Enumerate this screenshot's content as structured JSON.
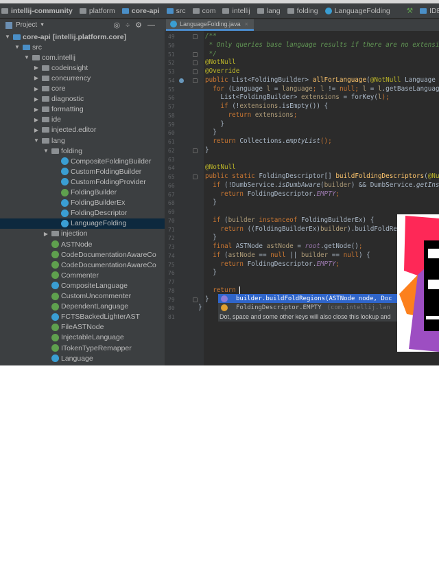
{
  "navbar": {
    "crumbs": [
      {
        "label": "intellij-community",
        "icon": "project-icon",
        "bold": true
      },
      {
        "label": "platform",
        "icon": "folder-icon"
      },
      {
        "label": "core-api",
        "icon": "module-icon",
        "bold": true
      },
      {
        "label": "src",
        "icon": "source-folder-icon"
      },
      {
        "label": "com",
        "icon": "folder-icon"
      },
      {
        "label": "intellij",
        "icon": "folder-icon"
      },
      {
        "label": "lang",
        "icon": "folder-icon"
      },
      {
        "label": "folding",
        "icon": "folder-icon"
      },
      {
        "label": "LanguageFolding",
        "icon": "class-icon"
      }
    ],
    "right_label": "IDE"
  },
  "tool_window": {
    "title": "Project"
  },
  "editor_tab": {
    "label": "LanguageFolding.java"
  },
  "tree": [
    {
      "label": "core-api [intellij.platform.core]",
      "depth": 0,
      "arrow": "down",
      "icon": "module",
      "bold": true
    },
    {
      "label": "src",
      "depth": 1,
      "arrow": "down",
      "icon": "src"
    },
    {
      "label": "com.intellij",
      "depth": 2,
      "arrow": "down",
      "icon": "folder"
    },
    {
      "label": "codeinsight",
      "depth": 3,
      "arrow": "right",
      "icon": "folder"
    },
    {
      "label": "concurrency",
      "depth": 3,
      "arrow": "right",
      "icon": "folder"
    },
    {
      "label": "core",
      "depth": 3,
      "arrow": "right",
      "icon": "folder"
    },
    {
      "label": "diagnostic",
      "depth": 3,
      "arrow": "right",
      "icon": "folder"
    },
    {
      "label": "formatting",
      "depth": 3,
      "arrow": "right",
      "icon": "folder"
    },
    {
      "label": "ide",
      "depth": 3,
      "arrow": "right",
      "icon": "folder"
    },
    {
      "label": "injected.editor",
      "depth": 3,
      "arrow": "right",
      "icon": "folder"
    },
    {
      "label": "lang",
      "depth": 3,
      "arrow": "down",
      "icon": "folder"
    },
    {
      "label": "folding",
      "depth": 4,
      "arrow": "down",
      "icon": "folder"
    },
    {
      "label": "CompositeFoldingBuilder",
      "depth": 5,
      "icon": "c"
    },
    {
      "label": "CustomFoldingBuilder",
      "depth": 5,
      "icon": "c"
    },
    {
      "label": "CustomFoldingProvider",
      "depth": 5,
      "icon": "c"
    },
    {
      "label": "FoldingBuilder",
      "depth": 5,
      "icon": "i"
    },
    {
      "label": "FoldingBuilderEx",
      "depth": 5,
      "icon": "c"
    },
    {
      "label": "FoldingDescriptor",
      "depth": 5,
      "icon": "c"
    },
    {
      "label": "LanguageFolding",
      "depth": 5,
      "icon": "c",
      "selected": true
    },
    {
      "label": "injection",
      "depth": 4,
      "arrow": "right",
      "icon": "folder"
    },
    {
      "label": "ASTNode",
      "depth": 4,
      "icon": "i"
    },
    {
      "label": "CodeDocumentationAwareCo",
      "depth": 4,
      "icon": "i"
    },
    {
      "label": "CodeDocumentationAwareCo",
      "depth": 4,
      "icon": "i"
    },
    {
      "label": "Commenter",
      "depth": 4,
      "icon": "i"
    },
    {
      "label": "CompositeLanguage",
      "depth": 4,
      "icon": "c"
    },
    {
      "label": "CustomUncommenter",
      "depth": 4,
      "icon": "i"
    },
    {
      "label": "DependentLanguage",
      "depth": 4,
      "icon": "i"
    },
    {
      "label": "FCTSBackedLighterAST",
      "depth": 4,
      "icon": "c"
    },
    {
      "label": "FileASTNode",
      "depth": 4,
      "icon": "i"
    },
    {
      "label": "InjectableLanguage",
      "depth": 4,
      "icon": "i"
    },
    {
      "label": "ITokenTypeRemapper",
      "depth": 4,
      "icon": "i"
    },
    {
      "label": "Language",
      "depth": 4,
      "icon": "c"
    }
  ],
  "code": [
    {
      "n": "49",
      "s": [
        [
          "/**",
          "c"
        ]
      ]
    },
    {
      "n": "50",
      "s": [
        [
          " * Only queries base language results if there are no extensio",
          "c"
        ]
      ]
    },
    {
      "n": "51",
      "s": [
        [
          " */",
          "c"
        ]
      ]
    },
    {
      "n": "52",
      "s": [
        [
          "@NotNull",
          "a"
        ]
      ]
    },
    {
      "n": "53",
      "s": [
        [
          "@Override",
          "a"
        ]
      ]
    },
    {
      "n": "54",
      "s": [
        [
          "public ",
          "k"
        ],
        [
          "List<FoldingBuilder> ",
          ""
        ],
        [
          "allForLanguage",
          "m"
        ],
        [
          "(",
          ""
        ],
        [
          "@NotNull ",
          "a"
        ],
        [
          "Language l",
          ""
        ]
      ]
    },
    {
      "n": "55",
      "s": [
        [
          "  for ",
          "k"
        ],
        [
          "(Language ",
          ""
        ],
        [
          "l",
          "lv"
        ],
        [
          " = ",
          ""
        ],
        [
          "language",
          "lv"
        ],
        [
          "; ",
          "k"
        ],
        [
          "l",
          "lv"
        ],
        [
          " != ",
          ""
        ],
        [
          "null",
          "k"
        ],
        [
          "; ",
          "k"
        ],
        [
          "l",
          "lv"
        ],
        [
          " = ",
          ""
        ],
        [
          "l",
          "lv"
        ],
        [
          ".getBaseLanguage",
          ""
        ]
      ]
    },
    {
      "n": "56",
      "s": [
        [
          "    List<FoldingBuilder> ",
          ""
        ],
        [
          "extensions",
          "lv"
        ],
        [
          " = forKey(",
          ""
        ],
        [
          "l",
          "lv"
        ],
        [
          ");",
          "k"
        ]
      ]
    },
    {
      "n": "57",
      "s": [
        [
          "    if ",
          "k"
        ],
        [
          "(!",
          ""
        ],
        [
          "extensions",
          "lv"
        ],
        [
          ".isEmpty()) {",
          ""
        ]
      ]
    },
    {
      "n": "58",
      "s": [
        [
          "      return ",
          "k"
        ],
        [
          "extensions",
          "lv"
        ],
        [
          ";",
          "k"
        ]
      ]
    },
    {
      "n": "59",
      "s": [
        [
          "    }",
          ""
        ]
      ]
    },
    {
      "n": "60",
      "s": [
        [
          "  }",
          ""
        ]
      ]
    },
    {
      "n": "61",
      "s": [
        [
          "  return ",
          "k"
        ],
        [
          "Collections.",
          ""
        ],
        [
          "emptyList",
          "it"
        ],
        [
          "();",
          "k"
        ]
      ]
    },
    {
      "n": "62",
      "s": [
        [
          "}",
          ""
        ]
      ]
    },
    {
      "n": "63",
      "s": []
    },
    {
      "n": "64",
      "s": [
        [
          "@NotNull",
          "a"
        ]
      ]
    },
    {
      "n": "65",
      "s": [
        [
          "public static ",
          "k"
        ],
        [
          "FoldingDescriptor[] ",
          ""
        ],
        [
          "buildFoldingDescriptors",
          "m"
        ],
        [
          "(",
          ""
        ],
        [
          "@Nul",
          "a"
        ]
      ]
    },
    {
      "n": "66",
      "s": [
        [
          "  if ",
          "k"
        ],
        [
          "(!DumbService.",
          ""
        ],
        [
          "isDumbAware",
          "it"
        ],
        [
          "(",
          ""
        ],
        [
          "builder",
          "lv"
        ],
        [
          ") && DumbService.",
          ""
        ],
        [
          "getInst",
          "it"
        ]
      ]
    },
    {
      "n": "67",
      "s": [
        [
          "    return ",
          "k"
        ],
        [
          "FoldingDescriptor.",
          ""
        ],
        [
          "EMPTY",
          "f"
        ],
        [
          ";",
          "k"
        ]
      ]
    },
    {
      "n": "68",
      "s": [
        [
          "  }",
          ""
        ]
      ]
    },
    {
      "n": "69",
      "s": []
    },
    {
      "n": "70",
      "s": [
        [
          "  if ",
          "k"
        ],
        [
          "(",
          ""
        ],
        [
          "builder ",
          "lv"
        ],
        [
          "instanceof ",
          "k"
        ],
        [
          "FoldingBuilderEx) {",
          ""
        ]
      ]
    },
    {
      "n": "71",
      "s": [
        [
          "    return ",
          "k"
        ],
        [
          "((FoldingBuilderEx)",
          ""
        ],
        [
          "builder",
          "lv"
        ],
        [
          ").buildFoldReg",
          ""
        ]
      ]
    },
    {
      "n": "72",
      "s": [
        [
          "  }",
          ""
        ]
      ]
    },
    {
      "n": "73",
      "s": [
        [
          "  final ",
          "k"
        ],
        [
          "ASTNode ",
          ""
        ],
        [
          "astNode",
          "lv"
        ],
        [
          " = ",
          ""
        ],
        [
          "root",
          "f"
        ],
        [
          ".getNode()",
          ""
        ],
        [
          ";",
          "k"
        ]
      ]
    },
    {
      "n": "74",
      "s": [
        [
          "  if ",
          "k"
        ],
        [
          "(",
          ""
        ],
        [
          "astNode",
          "lv"
        ],
        [
          " == ",
          ""
        ],
        [
          "null ",
          "k"
        ],
        [
          "|| ",
          ""
        ],
        [
          "builder",
          "lv"
        ],
        [
          " == ",
          ""
        ],
        [
          "null",
          "k"
        ],
        [
          ") {",
          ""
        ]
      ]
    },
    {
      "n": "75",
      "s": [
        [
          "    return ",
          "k"
        ],
        [
          "FoldingDescriptor.",
          ""
        ],
        [
          "EMPTY",
          "f"
        ],
        [
          ";",
          "k"
        ]
      ]
    },
    {
      "n": "76",
      "s": [
        [
          "  }",
          ""
        ]
      ]
    },
    {
      "n": "77",
      "s": []
    },
    {
      "n": "78",
      "s": [
        [
          "  return ",
          "k"
        ]
      ],
      "caret": true
    },
    {
      "n": "79",
      "s": [
        [
          "}",
          ""
        ]
      ]
    },
    {
      "n": "80",
      "s": [
        [
          "}",
          ""
        ]
      ],
      "outdent": true
    },
    {
      "n": "81",
      "s": []
    }
  ],
  "completion": {
    "items": [
      {
        "label": "builder.buildFoldRegions(ASTNode node, Doc",
        "icon": "method-icon",
        "selected": true
      },
      {
        "label": "FoldingDescriptor.EMPTY",
        "detail": "(com.intellij.lan",
        "icon": "field-icon"
      }
    ],
    "hint": "Dot, space and some other keys will also close this lookup and"
  },
  "colors": {
    "keyword": "#cc7832",
    "annotation": "#bbb529",
    "comment": "#629755",
    "method": "#ffc66d",
    "selection": "#2f65ca",
    "tree_selection": "#0d293e"
  }
}
